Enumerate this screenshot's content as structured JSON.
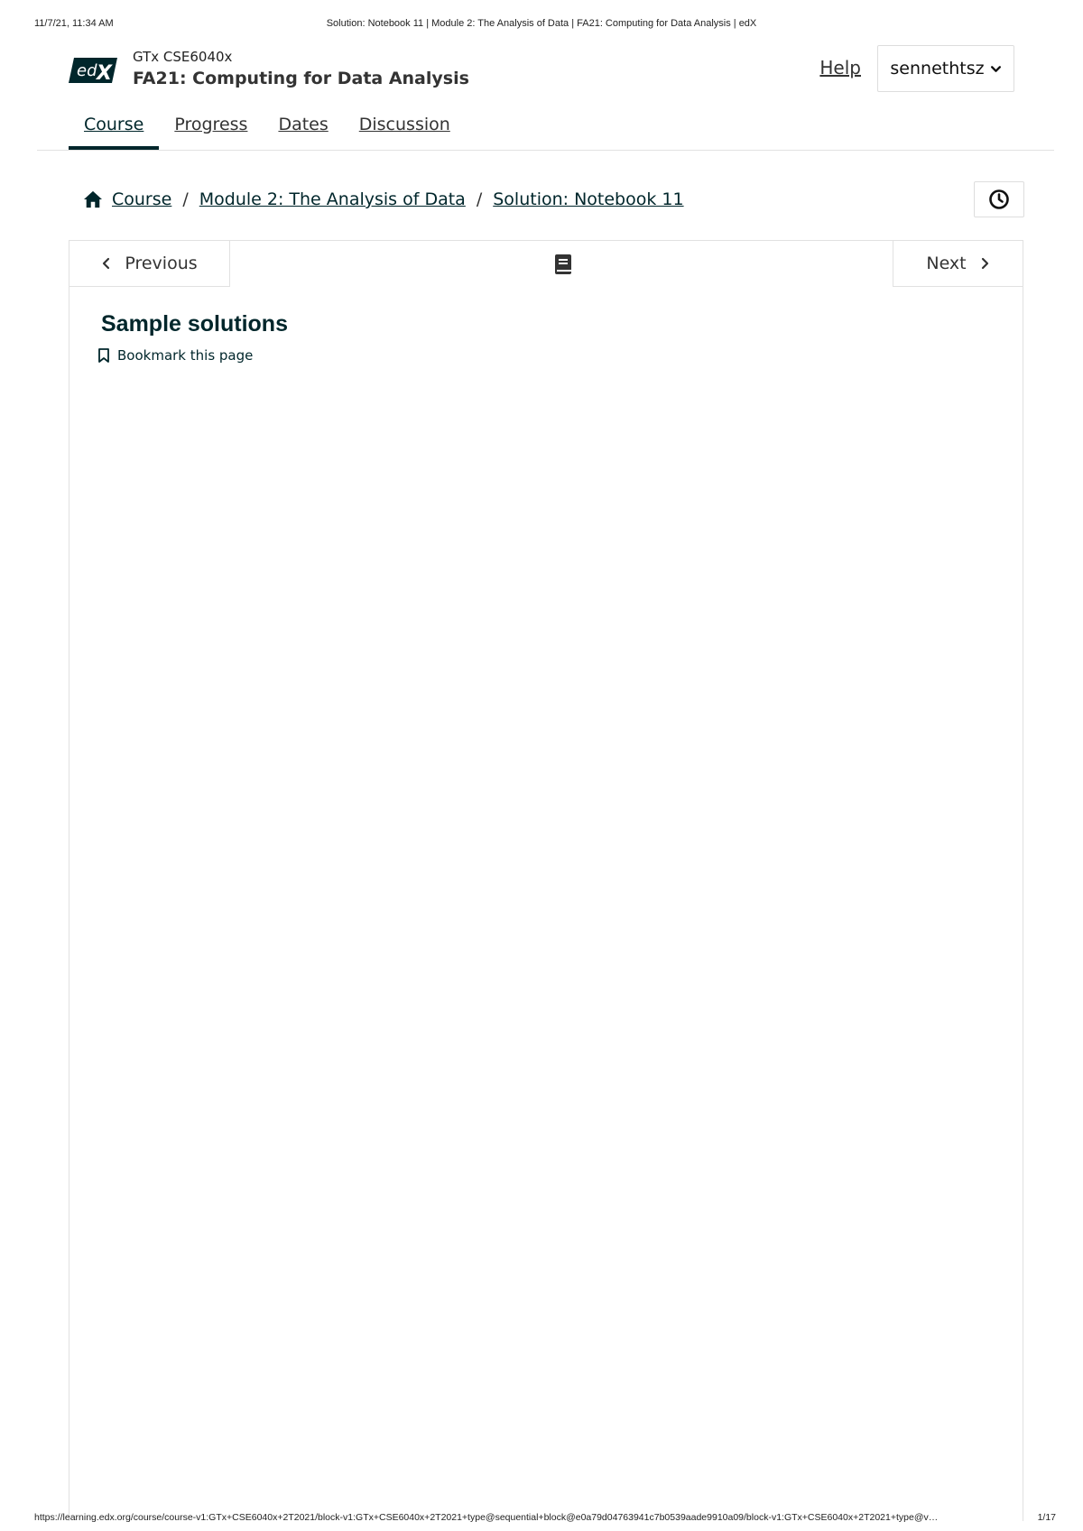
{
  "print_header": {
    "datetime": "11/7/21, 11:34 AM",
    "page_title": "Solution: Notebook 11 | Module 2: The Analysis of Data | FA21: Computing for Data Analysis | edX"
  },
  "header": {
    "logo_text": "edX",
    "course_org": "GTx CSE6040x",
    "course_title": "FA21: Computing for Data Analysis",
    "help_label": "Help",
    "username": "sennethtsz"
  },
  "tabs": [
    {
      "label": "Course",
      "active": true
    },
    {
      "label": "Progress",
      "active": false
    },
    {
      "label": "Dates",
      "active": false
    },
    {
      "label": "Discussion",
      "active": false
    }
  ],
  "breadcrumb": {
    "items": [
      "Course",
      "Module 2: The Analysis of Data",
      "Solution: Notebook 11"
    ],
    "separator": "/"
  },
  "sequence_nav": {
    "previous_label": "Previous",
    "next_label": "Next"
  },
  "content": {
    "heading": "Sample solutions",
    "bookmark_label": "Bookmark this page"
  },
  "print_footer": {
    "url": "https://learning.edx.org/course/course-v1:GTx+CSE6040x+2T2021/block-v1:GTx+CSE6040x+2T2021+type@sequential+block@e0a79d04763941c7b0539aade9910a09/block-v1:GTx+CSE6040x+2T2021+type@v…",
    "page_number": "1/17"
  },
  "colors": {
    "brand_dark": "#00262b",
    "text": "#333333",
    "border": "#e1e1e1"
  },
  "icons": [
    "home-icon",
    "history-icon",
    "chevron-left-icon",
    "chevron-right-icon",
    "book-icon",
    "bookmark-icon",
    "chevron-down-icon"
  ]
}
